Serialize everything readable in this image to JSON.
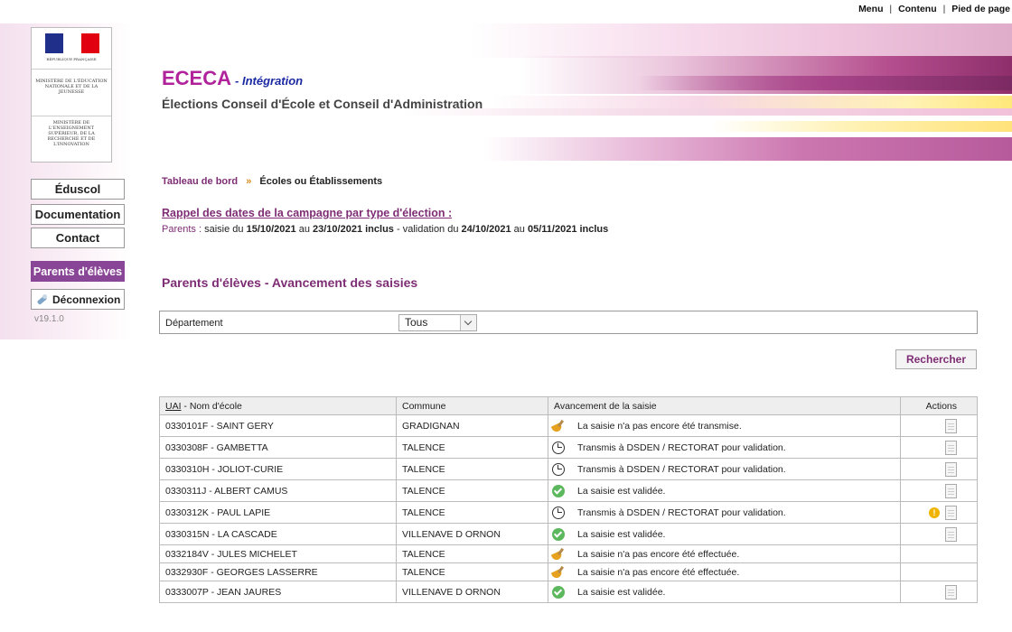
{
  "toplinks": {
    "menu": "Menu",
    "contenu": "Contenu",
    "pied": "Pied de page"
  },
  "logo": {
    "republique": "RÉPUBLIQUE FRANÇAISE",
    "ministere1": "MINISTÈRE DE L'ÉDUCATION NATIONALE ET DE LA JEUNESSE",
    "ministere2": "MINISTÈRE DE L'ENSEIGNEMENT SUPÉRIEUR, DE LA RECHERCHE ET DE L'INNOVATION"
  },
  "header": {
    "app_name": "ECECA",
    "env": "- Intégration",
    "subtitle": "Élections Conseil d'École et Conseil d'Administration"
  },
  "nav": {
    "eduscol": "Éduscol",
    "documentation": "Documentation",
    "contact": "Contact",
    "parents": "Parents d'élèves",
    "logout": "Déconnexion",
    "version": "v19.1.0"
  },
  "breadcrumb": {
    "home": "Tableau de bord",
    "sep": "»",
    "current": "Écoles ou Établissements"
  },
  "rappel": {
    "title": "Rappel des dates de la campagne par type d'élection :",
    "label": "Parents :",
    "t1": "saisie du",
    "d1": "15/10/2021",
    "t2": "au",
    "d2": "23/10/2021 inclus",
    "t3": "- validation du",
    "d3": "24/10/2021",
    "t4": "au",
    "d4": "05/11/2021 inclus"
  },
  "section_title": "Parents d'élèves - Avancement des saisies",
  "filter": {
    "label": "Département",
    "value": "Tous"
  },
  "search_button": "Rechercher",
  "table": {
    "headers": {
      "uai": "UAI",
      "nom": " - Nom d'école",
      "commune": "Commune",
      "avancement": "Avancement de la saisie",
      "actions": "Actions"
    },
    "rows": [
      {
        "ecole": "0330101F - SAINT GERY",
        "commune": "GRADIGNAN",
        "status": "brush",
        "text": "La saisie n'a pas encore été transmise.",
        "warn": false,
        "doc": true
      },
      {
        "ecole": "0330308F - GAMBETTA",
        "commune": "TALENCE",
        "status": "clock",
        "text": "Transmis à DSDEN / RECTORAT pour validation.",
        "warn": false,
        "doc": true
      },
      {
        "ecole": "0330310H - JOLIOT-CURIE",
        "commune": "TALENCE",
        "status": "clock",
        "text": "Transmis à DSDEN / RECTORAT pour validation.",
        "warn": false,
        "doc": true
      },
      {
        "ecole": "0330311J - ALBERT CAMUS",
        "commune": "TALENCE",
        "status": "ok",
        "text": "La saisie est validée.",
        "warn": false,
        "doc": true
      },
      {
        "ecole": "0330312K - PAUL LAPIE",
        "commune": "TALENCE",
        "status": "clock",
        "text": "Transmis à DSDEN / RECTORAT pour validation.",
        "warn": true,
        "doc": true
      },
      {
        "ecole": "0330315N - LA CASCADE",
        "commune": "VILLENAVE D ORNON",
        "status": "ok",
        "text": "La saisie est validée.",
        "warn": false,
        "doc": true
      },
      {
        "ecole": "0332184V - JULES MICHELET",
        "commune": "TALENCE",
        "status": "brush",
        "text": "La saisie n'a pas encore été effectuée.",
        "warn": false,
        "doc": false
      },
      {
        "ecole": "0332930F - GEORGES LASSERRE",
        "commune": "TALENCE",
        "status": "brush",
        "text": "La saisie n'a pas encore été effectuée.",
        "warn": false,
        "doc": false
      },
      {
        "ecole": "0333007P - JEAN JAURES",
        "commune": "VILLENAVE D ORNON",
        "status": "ok",
        "text": "La saisie est validée.",
        "warn": false,
        "doc": true
      }
    ]
  },
  "colors": {
    "brand": "#b0239b",
    "accent": "#7e2d74",
    "active_nav": "#8a4696"
  }
}
